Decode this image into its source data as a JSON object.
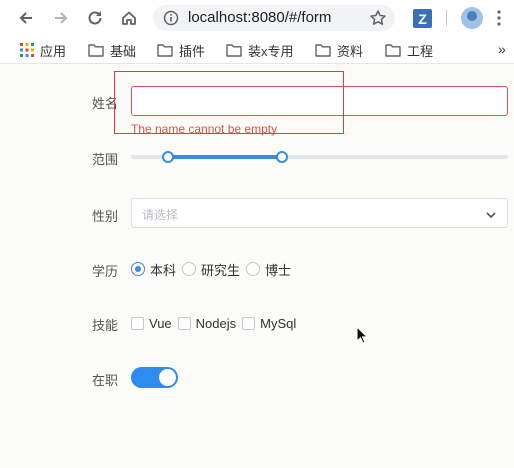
{
  "browser": {
    "url": "localhost:8080/#/form",
    "extension_letter": "Z",
    "bookmarks": [
      "应用",
      "基础",
      "插件",
      "装x专用",
      "资料",
      "工程"
    ],
    "more_label": "»"
  },
  "form": {
    "name": {
      "label": "姓名",
      "value": "",
      "error": "The name cannot be empty"
    },
    "range": {
      "label": "范围",
      "low": 0.1,
      "high": 0.4
    },
    "gender": {
      "label": "性别",
      "placeholder": "请选择"
    },
    "education": {
      "label": "学历",
      "options": [
        "本科",
        "研究生",
        "博士"
      ],
      "selected": "本科"
    },
    "skills": {
      "label": "技能",
      "options": [
        "Vue",
        "Nodejs",
        "MySql"
      ]
    },
    "employed": {
      "label": "在职",
      "on": true
    }
  },
  "colors": {
    "accent": "#3d8ad6",
    "switch_on": "#2d8cf0",
    "error": "#d9534f"
  }
}
